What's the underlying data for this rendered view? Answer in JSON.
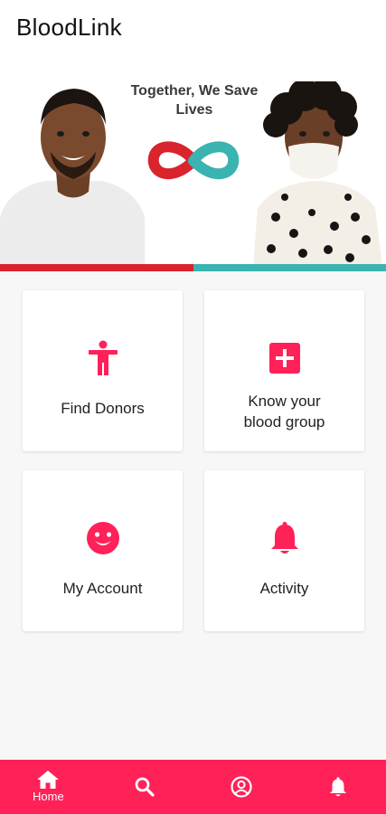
{
  "app": {
    "title": "BloodLink"
  },
  "banner": {
    "headline_line1": "Together, We Save",
    "headline_line2": "Lives"
  },
  "cards": [
    {
      "label": "Find Donors",
      "icon": "accessibility-icon"
    },
    {
      "label_line1": "Know your",
      "label_line2": "blood group",
      "icon": "plus-box-icon"
    },
    {
      "label": "My Account",
      "icon": "smiley-icon"
    },
    {
      "label": "Activity",
      "icon": "bell-icon"
    }
  ],
  "bottom_nav": {
    "items": [
      {
        "label": "Home",
        "icon": "home-icon",
        "active": true
      },
      {
        "label": "",
        "icon": "search-icon"
      },
      {
        "label": "",
        "icon": "account-circle-icon"
      },
      {
        "label": "",
        "icon": "bell-icon"
      }
    ]
  },
  "colors": {
    "accent": "#ff2157",
    "banner_red": "#d9232d",
    "banner_teal": "#3bb3b0"
  }
}
